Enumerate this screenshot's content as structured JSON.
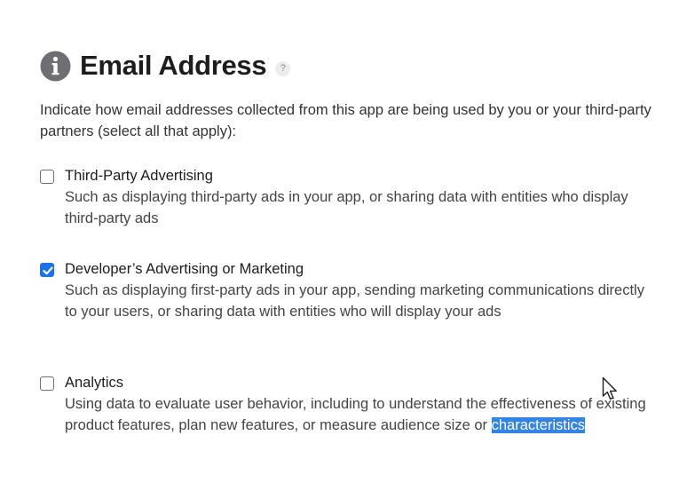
{
  "header": {
    "icon": "info-circle-icon",
    "title": "Email Address",
    "help_glyph": "?"
  },
  "intro_text": "Indicate how email addresses collected from this app are being used by you or your third-party partners (select all that apply):",
  "options": [
    {
      "label": "Third-Party Advertising",
      "description": "Such as displaying third-party ads in your app, or sharing data with entities who display third-party ads",
      "checked": false
    },
    {
      "label": "Developer’s Advertising or Marketing",
      "description": "Such as displaying first-party ads in your app, sending marketing communications directly to your users, or sharing data with entities who will display your ads",
      "checked": true
    },
    {
      "label": "Analytics",
      "description_plain": "Using data to evaluate user behavior, including to understand the effectiveness of existing product features, plan new features, or measure audience size or ",
      "description_selected": "characteristics",
      "checked": false
    }
  ],
  "colors": {
    "checkbox_checked": "#1a73e8",
    "selection_highlight": "#3584e4"
  }
}
